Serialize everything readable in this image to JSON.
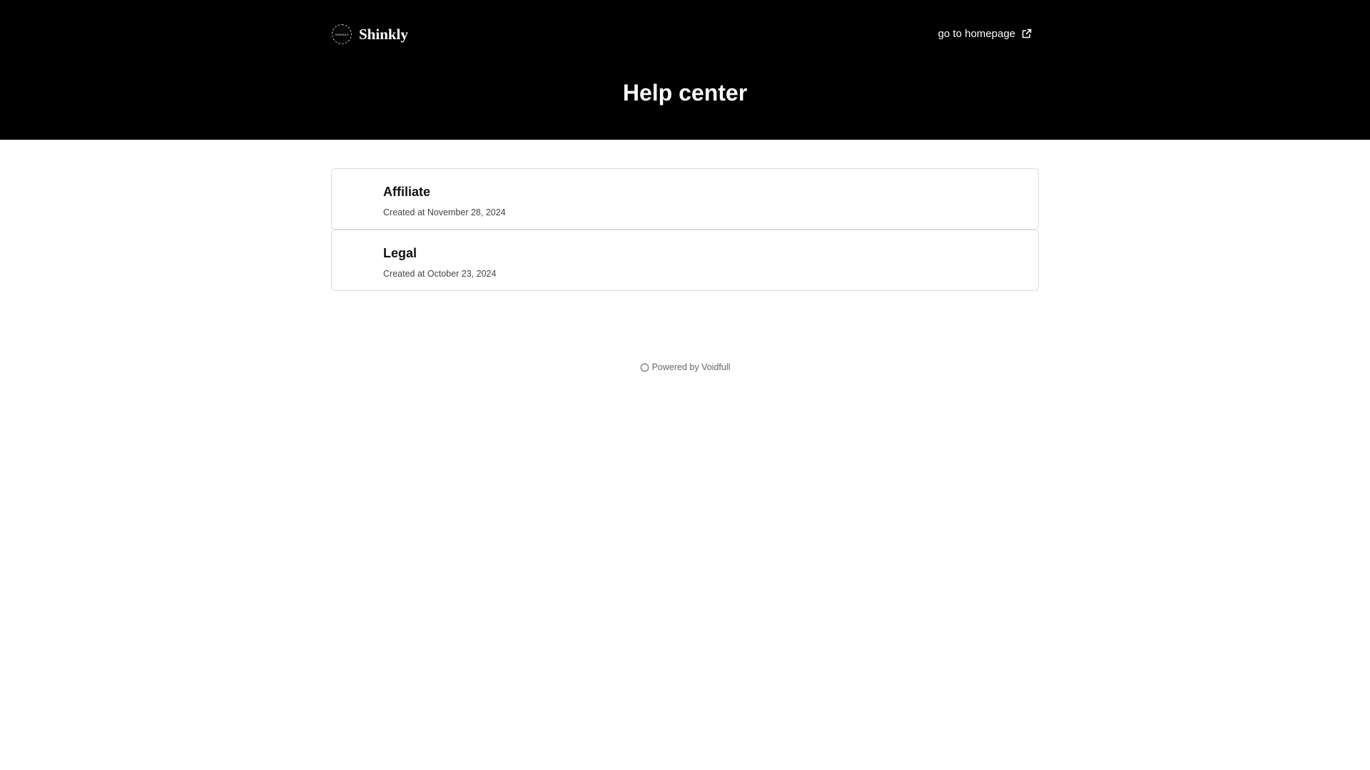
{
  "header": {
    "brand": {
      "name": "Shinkly",
      "badge_text": "SHINKLY"
    },
    "homepage_link": "go to homepage",
    "title": "Help center",
    "background_color": "#000000"
  },
  "collections": [
    {
      "title": "Affiliate",
      "meta": "Created at November 28, 2024"
    },
    {
      "title": "Legal",
      "meta": "Created at October 23, 2024"
    }
  ],
  "footer": {
    "powered_by": "Powered by Voidfull",
    "icon": "voidfull-logo-icon"
  },
  "icons": {
    "external_link": "external-link-icon"
  }
}
